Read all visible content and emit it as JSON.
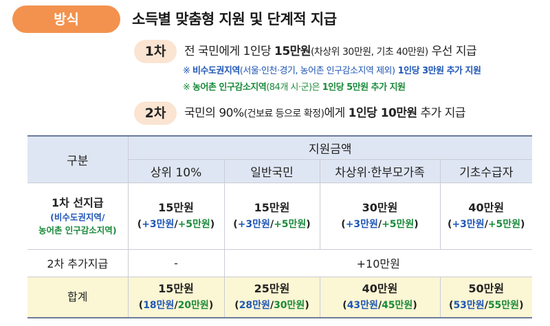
{
  "header": {
    "badge": "방식",
    "headline": "소득별 맞춤형 지원 및 단계적 지급"
  },
  "stage1": {
    "label": "1차",
    "text_a": "전 국민에게 1인당 ",
    "amount": "15만원",
    "paren": "(차상위 30만원, 기초 40만원)",
    "text_b": " 우선 지급",
    "note1_prefix": "※ ",
    "note1_bold": "비수도권지역",
    "note1_paren": "(서울·인천·경기, 농어촌 인구감소지역 제외)",
    "note1_tail": " 1인당 3만원 추가 지원",
    "note2_prefix": "※ ",
    "note2_bold": "농어촌 인구감소지역",
    "note2_paren": "(84개 시·군)은 ",
    "note2_tail": "1인당 5만원 추가 지원"
  },
  "stage2": {
    "label": "2차",
    "text_a": "국민의 90%",
    "paren": "(건보료 등으로 확정)",
    "text_b": "에게 ",
    "amount": "1인당 10만원",
    "text_c": " 추가 지급"
  },
  "table": {
    "col_group": "구분",
    "amount_header": "지원금액",
    "columns": [
      "상위 10%",
      "일반국민",
      "차상위·한부모가족",
      "기초수급자"
    ],
    "row1": {
      "label": "1차 선지급",
      "sub_open": "(",
      "sub_blue": "비수도권지역",
      "sub_slash": "/",
      "sub_green": "농어촌 인구감소지역",
      "sub_close": ")",
      "cells": [
        {
          "main": "15만원",
          "blue": "+3만원",
          "green": "+5만원"
        },
        {
          "main": "15만원",
          "blue": "+3만원",
          "green": "+5만원"
        },
        {
          "main": "30만원",
          "blue": "+3만원",
          "green": "+5만원"
        },
        {
          "main": "40만원",
          "blue": "+3만원",
          "green": "+5만원"
        }
      ]
    },
    "row2": {
      "label": "2차 추가지급",
      "first": "-",
      "merged": "+10만원"
    },
    "row3": {
      "label": "합계",
      "cells": [
        {
          "main": "15만원",
          "blue": "18만원",
          "green": "20만원"
        },
        {
          "main": "25만원",
          "blue": "28만원",
          "green": "30만원"
        },
        {
          "main": "40만원",
          "blue": "43만원",
          "green": "45만원"
        },
        {
          "main": "50만원",
          "blue": "53만원",
          "green": "55만원"
        }
      ]
    },
    "paren_open": "(",
    "slash": "/",
    "paren_close": ")"
  },
  "colors": {
    "badge": "#f3924e",
    "stage_pill": "#fbe4d2",
    "header_bg": "#dfe6f3",
    "total_bg": "#fbf6d4",
    "blue": "#1f56b5",
    "green": "#1a8a3a"
  }
}
